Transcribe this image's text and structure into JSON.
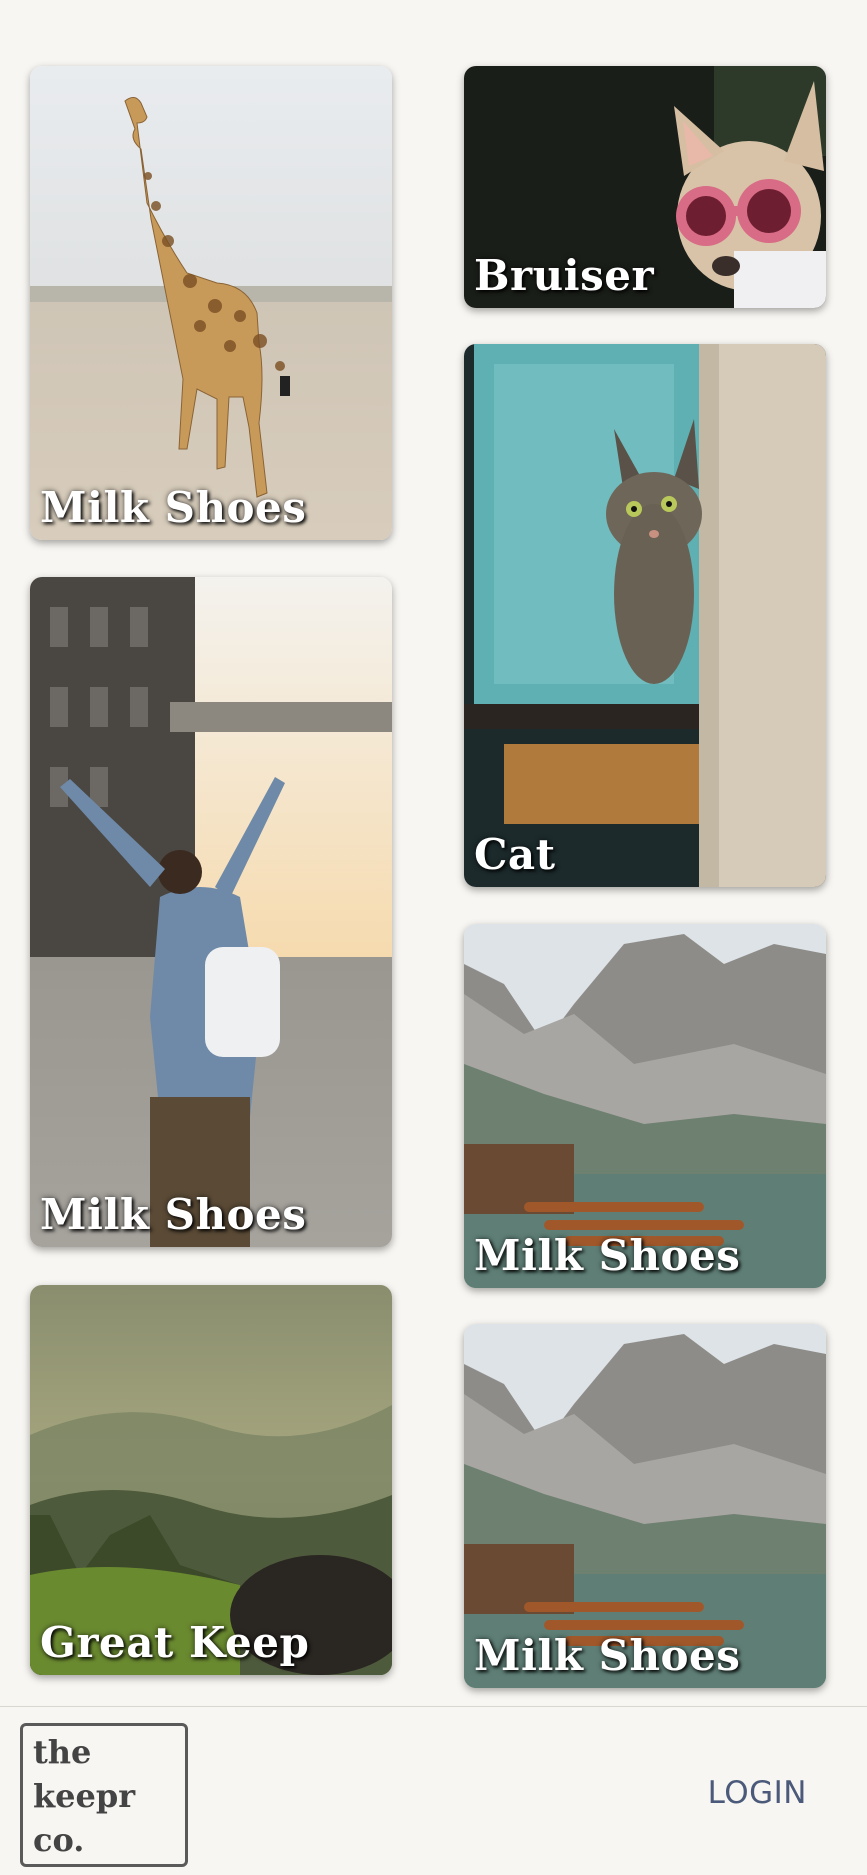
{
  "cards": [
    {
      "caption": "Milk Shoes",
      "image": "giraffe-photo"
    },
    {
      "caption": "Bruiser",
      "image": "dog-goggles-photo"
    },
    {
      "caption": "Milk Shoes",
      "image": "backpacker-photo"
    },
    {
      "caption": "Cat",
      "image": "cat-peeking-photo"
    },
    {
      "caption": "Milk Shoes",
      "image": "mountain-lake-photo"
    },
    {
      "caption": "Great Keep",
      "image": "misty-mountains-photo"
    },
    {
      "caption": "Milk Shoes",
      "image": "mountain-lake-photo"
    }
  ],
  "footer": {
    "logo_lines": [
      "the",
      "keepr",
      "co."
    ],
    "login_label": "LOGIN"
  },
  "colors": {
    "background": "#f8f6f2",
    "login_text": "#4b5a7a",
    "logo_border": "#5a5a5a"
  }
}
